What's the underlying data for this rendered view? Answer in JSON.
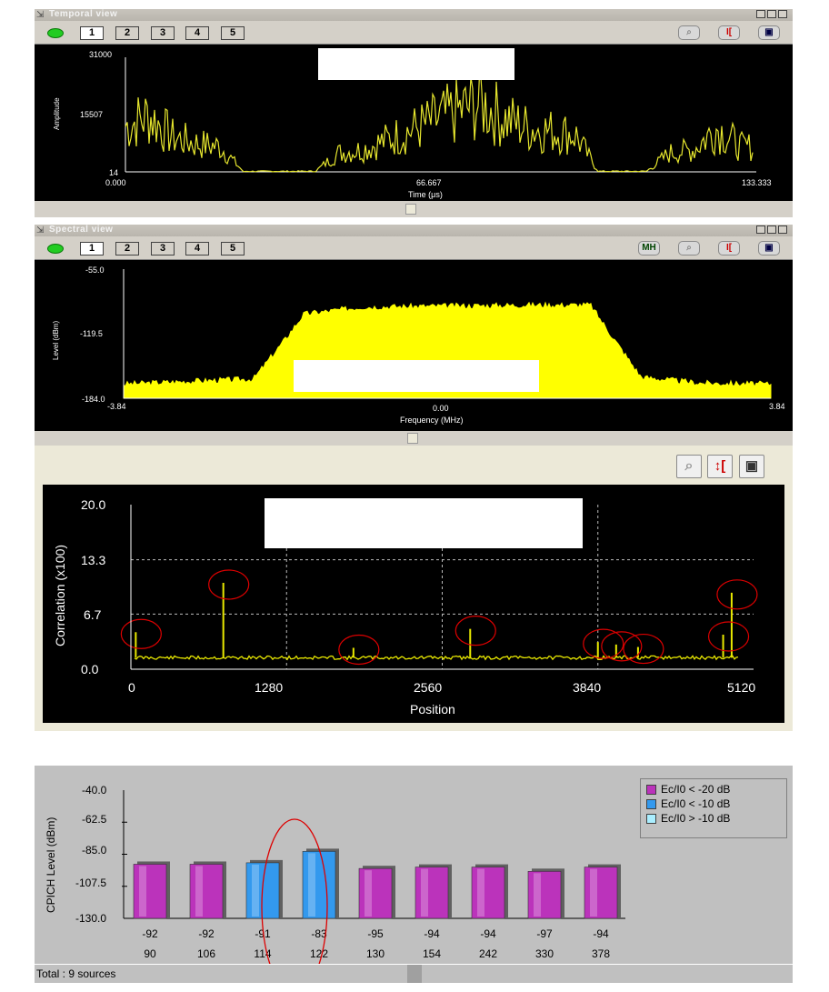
{
  "temporal": {
    "title": "Temporal view",
    "tabs": [
      "1",
      "2",
      "3",
      "4",
      "5"
    ],
    "ylabel": "Amplitude",
    "xlabel": "Time (μs)",
    "yticks": [
      "31000",
      "15507",
      "14"
    ],
    "xticks": [
      "0.000",
      "66.667",
      "133.333"
    ],
    "trace_color": "#e6e62e"
  },
  "spectral": {
    "title": "Spectral view",
    "tabs": [
      "1",
      "2",
      "3",
      "4",
      "5"
    ],
    "mh_label": "MH",
    "ylabel": "Level (dBm)",
    "xlabel": "Frequency (MHz)",
    "yticks": [
      "-55.0",
      "-119.5",
      "-184.0"
    ],
    "xticks": [
      "-3.84",
      "0.00",
      "3.84"
    ],
    "fill_color": "#ffff00"
  },
  "correlation": {
    "ylabel": "Correlation (x100)",
    "xlabel": "Position",
    "yticks": [
      "20.0",
      "13.3",
      "6.7",
      "0.0"
    ],
    "xticks": [
      "0",
      "1280",
      "2560",
      "3840",
      "5120"
    ],
    "trace_color": "#e8e800",
    "circle_color": "#dd0000",
    "peaks": [
      {
        "x": 40,
        "y": 4.5
      },
      {
        "x": 760,
        "y": 10.5
      },
      {
        "x": 1830,
        "y": 2.6
      },
      {
        "x": 2790,
        "y": 4.9
      },
      {
        "x": 3840,
        "y": 3.3
      },
      {
        "x": 3990,
        "y": 3.0
      },
      {
        "x": 4170,
        "y": 2.7
      },
      {
        "x": 4870,
        "y": 4.2
      },
      {
        "x": 4940,
        "y": 9.3
      }
    ]
  },
  "cpich": {
    "ylabel": "CPICH Level (dBm)",
    "yticks": [
      "-40.0",
      "-62.5",
      "-85.0",
      "-107.5",
      "-130.0"
    ],
    "legend": [
      {
        "label": "Ec/I0 < -20 dB",
        "color": "#bb33bb"
      },
      {
        "label": "Ec/I0 < -10 dB",
        "color": "#3399ee"
      },
      {
        "label": "Ec/I0 > -10 dB",
        "color": "#aaeeff"
      }
    ],
    "status": "Total : 9 sources",
    "bars": [
      {
        "level": "-92",
        "code": "90",
        "value": -92,
        "class": 0
      },
      {
        "level": "-92",
        "code": "106",
        "value": -92,
        "class": 0
      },
      {
        "level": "-91",
        "code": "114",
        "value": -91,
        "class": 1
      },
      {
        "level": "-83",
        "code": "122",
        "value": -83,
        "class": 1
      },
      {
        "level": "-95",
        "code": "130",
        "value": -95,
        "class": 0
      },
      {
        "level": "-94",
        "code": "154",
        "value": -94,
        "class": 0
      },
      {
        "level": "-94",
        "code": "242",
        "value": -94,
        "class": 0
      },
      {
        "level": "-97",
        "code": "330",
        "value": -97,
        "class": 0
      },
      {
        "level": "-94",
        "code": "378",
        "value": -94,
        "class": 0
      }
    ]
  },
  "chart_data": [
    {
      "type": "line",
      "title": "",
      "xlabel": "Time (μs)",
      "ylabel": "Amplitude",
      "xlim": [
        0,
        133.333
      ],
      "ylim": [
        14,
        31000
      ],
      "x": [
        0,
        5,
        10,
        15,
        20,
        25,
        30,
        35,
        40,
        45,
        50,
        55,
        60,
        65,
        70,
        75,
        80,
        85,
        90,
        95,
        100,
        105,
        110,
        115,
        120,
        125,
        130
      ],
      "series": [
        {
          "values": [
            14500,
            18000,
            11000,
            9000,
            8000,
            14,
            14,
            14,
            14,
            6000,
            7000,
            10000,
            13000,
            16000,
            19000,
            22000,
            17000,
            14000,
            13000,
            12000,
            14,
            14,
            14,
            6000,
            7000,
            14000,
            8000
          ]
        }
      ]
    },
    {
      "type": "area",
      "title": "",
      "xlabel": "Frequency (MHz)",
      "ylabel": "Level (dBm)",
      "xlim": [
        -3.84,
        3.84
      ],
      "ylim": [
        -184.0,
        -55.0
      ],
      "x": [
        -3.84,
        -3.0,
        -2.3,
        -1.92,
        -1.7,
        -1.0,
        0.0,
        1.0,
        1.7,
        1.92,
        2.3,
        3.0,
        3.84
      ],
      "series": [
        {
          "values": [
            -170,
            -167,
            -165,
            -125,
            -100,
            -93,
            -92,
            -91,
            -91,
            -118,
            -163,
            -169,
            -170
          ]
        }
      ]
    },
    {
      "type": "line",
      "title": "",
      "xlabel": "Position",
      "ylabel": "Correlation (x100)",
      "xlim": [
        0,
        5120
      ],
      "ylim": [
        0.0,
        20.0
      ],
      "grid": true,
      "x": [
        40,
        760,
        1830,
        2790,
        3840,
        3990,
        4170,
        4870,
        4940
      ],
      "series": [
        {
          "values": [
            4.5,
            10.5,
            2.6,
            4.9,
            3.3,
            3.0,
            2.7,
            4.2,
            9.3
          ]
        }
      ]
    },
    {
      "type": "bar",
      "title": "",
      "ylabel": "CPICH Level (dBm)",
      "ylim": [
        -130.0,
        -40.0
      ],
      "categories": [
        "90",
        "106",
        "114",
        "122",
        "130",
        "154",
        "242",
        "330",
        "378"
      ],
      "values": [
        -92,
        -92,
        -91,
        -83,
        -95,
        -94,
        -94,
        -97,
        -94
      ],
      "legend": [
        "Ec/I0 < -20 dB",
        "Ec/I0 < -10 dB",
        "Ec/I0 > -10 dB"
      ],
      "legend_position": "top-right"
    }
  ]
}
